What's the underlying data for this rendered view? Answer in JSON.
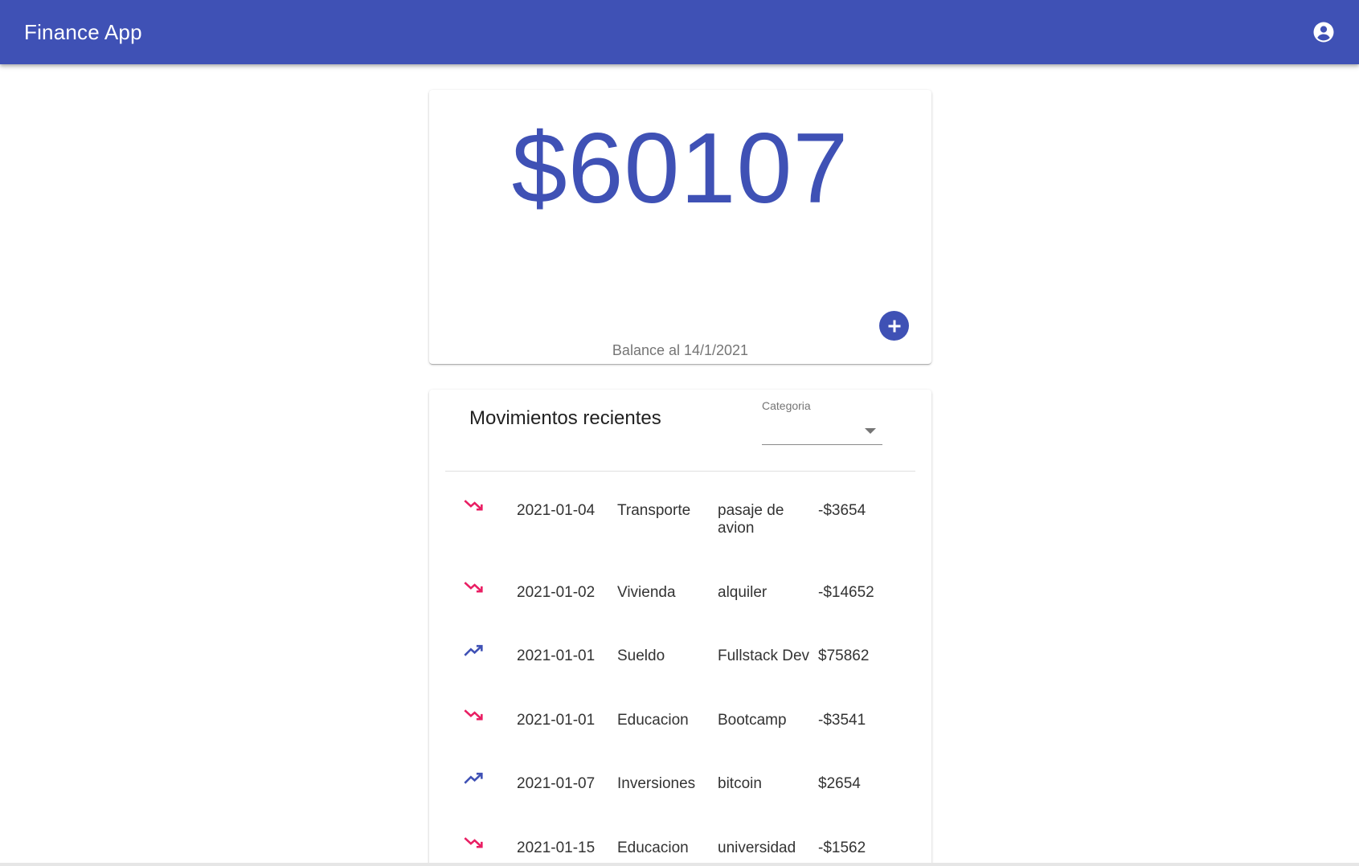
{
  "appbar": {
    "title": "Finance App",
    "account_icon": "account-circle-icon",
    "color": "#3f51b5"
  },
  "balance": {
    "amount": "$60107",
    "caption": "Balance al 14/1/2021",
    "add_icon": "plus-icon"
  },
  "movements": {
    "title": "Movimientos recientes",
    "category_filter": {
      "label": "Categoria",
      "selected": ""
    },
    "rows": [
      {
        "trend": "down",
        "icon": "trending-down-icon",
        "date": "2021-01-04",
        "category": "Transporte",
        "description": "pasaje de avion",
        "amount": "-$3654"
      },
      {
        "trend": "down",
        "icon": "trending-down-icon",
        "date": "2021-01-02",
        "category": "Vivienda",
        "description": "alquiler",
        "amount": "-$14652"
      },
      {
        "trend": "up",
        "icon": "trending-up-icon",
        "date": "2021-01-01",
        "category": "Sueldo",
        "description": "Fullstack Dev",
        "amount": "$75862"
      },
      {
        "trend": "down",
        "icon": "trending-down-icon",
        "date": "2021-01-01",
        "category": "Educacion",
        "description": "Bootcamp",
        "amount": "-$3541"
      },
      {
        "trend": "up",
        "icon": "trending-up-icon",
        "date": "2021-01-07",
        "category": "Inversiones",
        "description": "bitcoin",
        "amount": "$2654"
      },
      {
        "trend": "down",
        "icon": "trending-down-icon",
        "date": "2021-01-15",
        "category": "Educacion",
        "description": "universidad",
        "amount": "-$1562"
      }
    ],
    "colors": {
      "up": "#3f51b5",
      "down": "#e91e63"
    }
  }
}
